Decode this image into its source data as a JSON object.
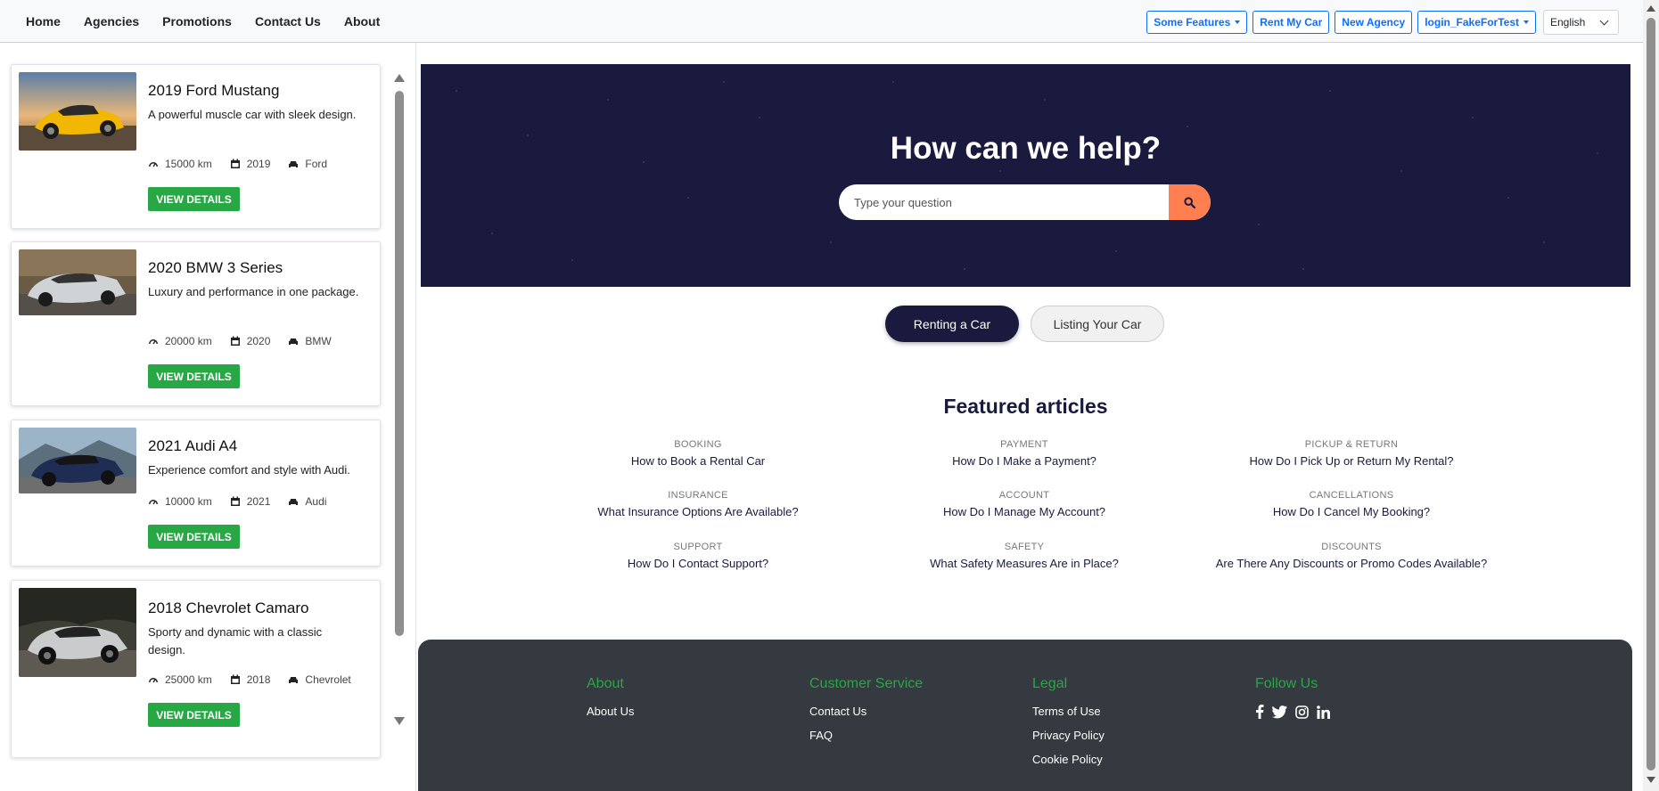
{
  "nav": {
    "links": [
      "Home",
      "Agencies",
      "Promotions",
      "Contact Us",
      "About"
    ],
    "some_features": "Some Features",
    "rent_my_car": "Rent My Car",
    "new_agency": "New Agency",
    "user": "login_FakeForTest",
    "language": "English"
  },
  "cars": [
    {
      "title": "2019 Ford Mustang",
      "desc": "A powerful muscle car with sleek design.",
      "km": "15000 km",
      "year": "2019",
      "make": "Ford",
      "button": "VIEW DETAILS"
    },
    {
      "title": "2020 BMW 3 Series",
      "desc": "Luxury and performance in one package.",
      "km": "20000 km",
      "year": "2020",
      "make": "BMW",
      "button": "VIEW DETAILS"
    },
    {
      "title": "2021 Audi A4",
      "desc": "Experience comfort and style with Audi.",
      "km": "10000 km",
      "year": "2021",
      "make": "Audi",
      "button": "VIEW DETAILS"
    },
    {
      "title": "2018 Chevrolet Camaro",
      "desc": "Sporty and dynamic with a classic design.",
      "km": "25000 km",
      "year": "2018",
      "make": "Chevrolet",
      "button": "VIEW DETAILS"
    }
  ],
  "hero": {
    "title": "How can we help?",
    "search_placeholder": "Type your question"
  },
  "tabs": {
    "active": "Renting a Car",
    "inactive": "Listing Your Car"
  },
  "featured": {
    "title": "Featured articles",
    "articles": [
      {
        "category": "BOOKING",
        "title": "How to Book a Rental Car"
      },
      {
        "category": "PAYMENT",
        "title": "How Do I Make a Payment?"
      },
      {
        "category": "PICKUP & RETURN",
        "title": "How Do I Pick Up or Return My Rental?"
      },
      {
        "category": "INSURANCE",
        "title": "What Insurance Options Are Available?"
      },
      {
        "category": "ACCOUNT",
        "title": "How Do I Manage My Account?"
      },
      {
        "category": "CANCELLATIONS",
        "title": "How Do I Cancel My Booking?"
      },
      {
        "category": "SUPPORT",
        "title": "How Do I Contact Support?"
      },
      {
        "category": "SAFETY",
        "title": "What Safety Measures Are in Place?"
      },
      {
        "category": "DISCOUNTS",
        "title": "Are There Any Discounts or Promo Codes Available?"
      }
    ]
  },
  "footer": {
    "about": {
      "heading": "About",
      "links": [
        "About Us"
      ]
    },
    "customer_service": {
      "heading": "Customer Service",
      "links": [
        "Contact Us",
        "FAQ"
      ]
    },
    "legal": {
      "heading": "Legal",
      "links": [
        "Terms of Use",
        "Privacy Policy",
        "Cookie Policy"
      ]
    },
    "follow": {
      "heading": "Follow Us",
      "icons": [
        "facebook-icon",
        "twitter-icon",
        "instagram-icon",
        "linkedin-icon"
      ]
    }
  },
  "colors": {
    "accent_green": "#28a745",
    "hero_navy": "#1a1a3e",
    "search_orange": "#ff7f50",
    "link_blue": "#0d6efd",
    "footer_dark": "#343a40"
  }
}
